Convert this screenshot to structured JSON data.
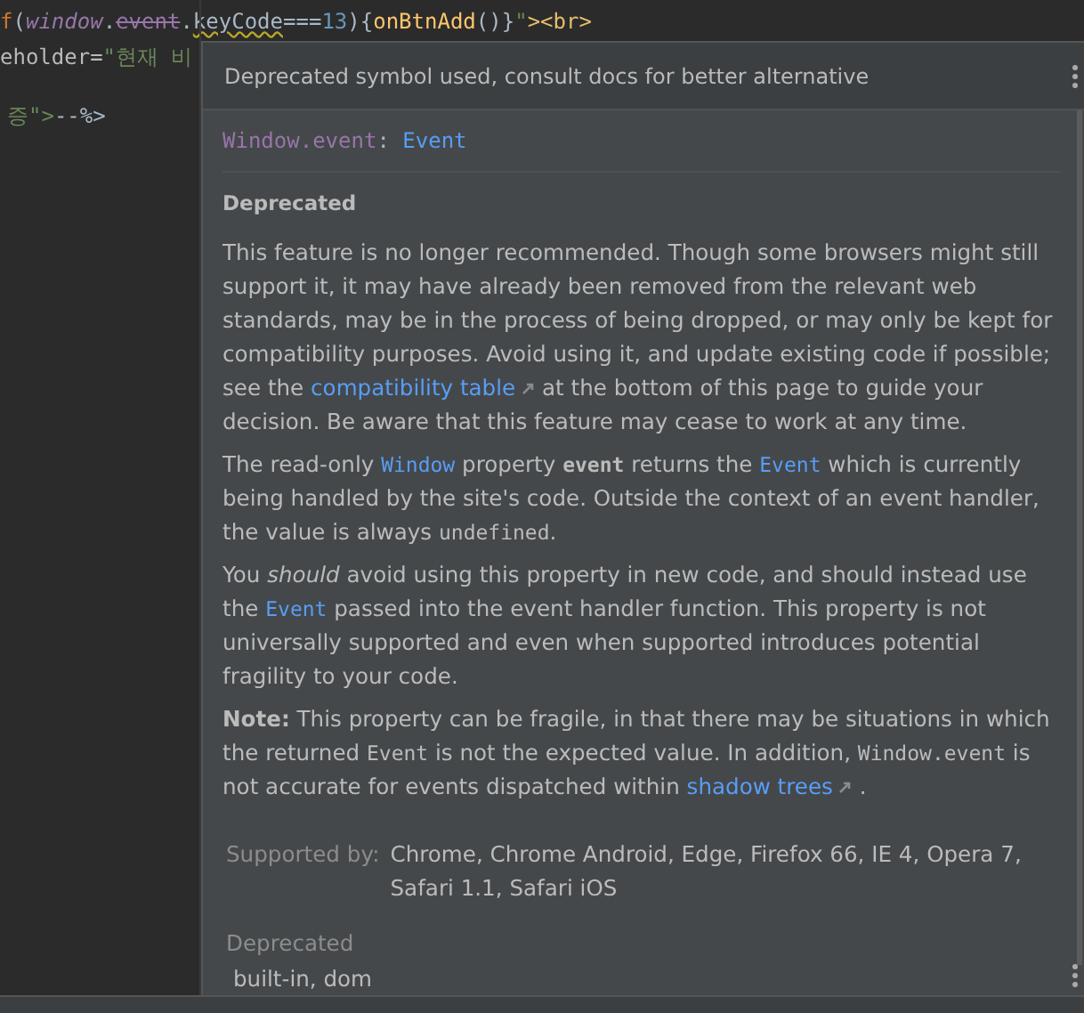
{
  "code_lines": [
    {
      "tokens": [
        {
          "text": "f",
          "kind": "keyword"
        },
        {
          "text": "(",
          "kind": "plain"
        },
        {
          "text": "window",
          "kind": "global"
        },
        {
          "text": ".",
          "kind": "plain"
        },
        {
          "text": "event",
          "kind": "deprecated"
        },
        {
          "text": ".",
          "kind": "plain"
        },
        {
          "text": "keyCode",
          "kind": "warning"
        },
        {
          "text": "===",
          "kind": "plain"
        },
        {
          "text": "13",
          "kind": "number"
        },
        {
          "text": "){",
          "kind": "plain"
        },
        {
          "text": "onBtnAdd",
          "kind": "function"
        },
        {
          "text": "()}",
          "kind": "plain"
        },
        {
          "text": "\"",
          "kind": "string"
        },
        {
          "text": "><br>",
          "kind": "tag"
        }
      ]
    },
    {
      "tokens": [
        {
          "text": "eholder=",
          "kind": "attr"
        },
        {
          "text": "\"현재 비",
          "kind": "string"
        }
      ]
    },
    {
      "tokens": [
        {
          "text": "증\">",
          "kind": "string"
        },
        {
          "text": "--%>",
          "kind": "plain"
        }
      ]
    }
  ],
  "popup": {
    "header": "Deprecated symbol used, consult docs for better alternative",
    "signature": [
      {
        "text": "Window.event",
        "kind": "owner"
      },
      {
        "text": ": ",
        "kind": "plain"
      },
      {
        "text": "Event",
        "kind": "type"
      }
    ],
    "section_title": "Deprecated",
    "paragraphs": [
      [
        {
          "text": "This feature is no longer recommended. Though some browsers might still support it, it may have already been removed from the relevant web standards, may be in the process of being dropped, or may only be kept for compatibility purposes. Avoid using it, and update existing code if possible; see the ",
          "kind": "text"
        },
        {
          "text": "compatibility table",
          "kind": "link",
          "external": true
        },
        {
          "text": " at the bottom of this page to guide your decision. Be aware that this feature may cease to work at any time.",
          "kind": "text"
        }
      ],
      [
        {
          "text": "The read-only ",
          "kind": "text"
        },
        {
          "text": "Window",
          "kind": "code_link"
        },
        {
          "text": " property ",
          "kind": "text"
        },
        {
          "text": "event",
          "kind": "code_bold"
        },
        {
          "text": " returns the ",
          "kind": "text"
        },
        {
          "text": "Event",
          "kind": "code_link"
        },
        {
          "text": " which is currently being handled by the site's code. Outside the context of an event handler, the value is always ",
          "kind": "text"
        },
        {
          "text": "undefined",
          "kind": "code"
        },
        {
          "text": ".",
          "kind": "text"
        }
      ],
      [
        {
          "text": "You *should* avoid using this property in new code, and should instead use the ",
          "kind": "text"
        },
        {
          "text": "Event",
          "kind": "code_link"
        },
        {
          "text": " passed into the event handler function. This property is not universally supported and even when supported introduces potential fragility to your code.",
          "kind": "text"
        }
      ],
      [
        {
          "text": "**Note:** This property can be fragile, in that there may be situations in which the returned ",
          "kind": "text"
        },
        {
          "text": "Event",
          "kind": "code"
        },
        {
          "text": " is not the expected value. In addition, ",
          "kind": "text"
        },
        {
          "text": "Window.event",
          "kind": "code"
        },
        {
          "text": " is not accurate for events dispatched within ",
          "kind": "text"
        },
        {
          "text": "shadow trees",
          "kind": "link",
          "external": true
        },
        {
          "text": " .",
          "kind": "text"
        }
      ]
    ],
    "supported_label": "Supported by:",
    "supported_value": "Chrome, Chrome Android, Edge, Firefox 66, IE 4, Opera 7, Safari 1.1, Safari iOS",
    "status_label": "Deprecated",
    "library": "built-in, dom"
  }
}
